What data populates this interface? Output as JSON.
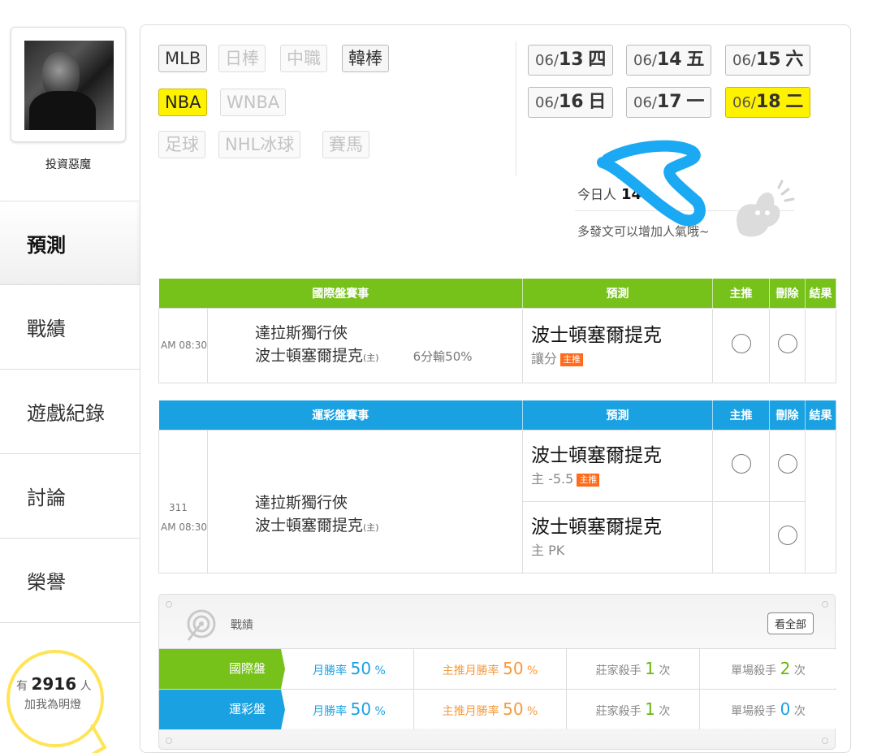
{
  "user": {
    "name": "投資惡魔"
  },
  "nav": [
    {
      "label": "預測"
    },
    {
      "label": "戰績"
    },
    {
      "label": "遊戲紀錄"
    },
    {
      "label": "討論"
    },
    {
      "label": "榮譽"
    }
  ],
  "fans": {
    "prefix": "有",
    "count": "2916",
    "suffix": "人",
    "line2": "加我為明燈"
  },
  "leagues": [
    {
      "label": "MLB",
      "state": "normal"
    },
    {
      "label": "日棒",
      "state": "disabled"
    },
    {
      "label": "中職",
      "state": "disabled"
    },
    {
      "label": "韓棒",
      "state": "normal"
    },
    {
      "label": "NBA",
      "state": "active"
    },
    {
      "label": "WNBA",
      "state": "disabled"
    },
    {
      "label": "足球",
      "state": "disabled"
    },
    {
      "label": "NHL冰球",
      "state": "disabled"
    },
    {
      "label": "賽馬",
      "state": "disabled"
    }
  ],
  "dates": [
    {
      "md": "06/",
      "day": "13",
      "wd": "四"
    },
    {
      "md": "06/",
      "day": "14",
      "wd": "五"
    },
    {
      "md": "06/",
      "day": "15",
      "wd": "六"
    },
    {
      "md": "06/",
      "day": "16",
      "wd": "日"
    },
    {
      "md": "06/",
      "day": "17",
      "wd": "一"
    },
    {
      "md": "06/",
      "day": "18",
      "wd": "二"
    }
  ],
  "visits": {
    "label": "今日人",
    "count": "14",
    "tip": "多發文可以增加人氣哦~"
  },
  "intl": {
    "headers": [
      "國際盤賽事",
      "預測",
      "主推",
      "刪除",
      "結果"
    ],
    "time": "AM 08:30",
    "away": "達拉斯獨行俠",
    "home": "波士頓塞爾提克",
    "home_tag": "(主)",
    "handicap": "6分輸50%",
    "pick": "波士頓塞爾提克",
    "pick_sub": "讓分",
    "badge": "主推"
  },
  "sports": {
    "headers": [
      "運彩盤賽事",
      "預測",
      "主推",
      "刪除",
      "結果"
    ],
    "num": "311",
    "time": "AM 08:30",
    "away": "達拉斯獨行俠",
    "home": "波士頓塞爾提克",
    "home_tag": "(主)",
    "pick1": "波士頓塞爾提克",
    "pick1_sub": "主 -5.5",
    "badge": "主推",
    "pick2": "波士頓塞爾提克",
    "pick2_sub": "主 PK"
  },
  "stats": {
    "title": "戰績",
    "see_all": "看全部",
    "rows": [
      {
        "label": "國際盤",
        "month_label": "月勝率",
        "month": "50",
        "pct": "%",
        "main_label": "主推月勝率",
        "main": "50",
        "banker_label": "莊家殺手",
        "banker": "1",
        "times": "次",
        "single_label": "單場殺手",
        "single": "2"
      },
      {
        "label": "運彩盤",
        "month_label": "月勝率",
        "month": "50",
        "pct": "%",
        "main_label": "主推月勝率",
        "main": "50",
        "banker_label": "莊家殺手",
        "banker": "1",
        "times": "次",
        "single_label": "單場殺手",
        "single": "0"
      }
    ]
  },
  "colors": {
    "green": "#77c11b",
    "blue": "#1aa1e2",
    "yellow": "#fff200",
    "orange": "#ff6a1b"
  }
}
